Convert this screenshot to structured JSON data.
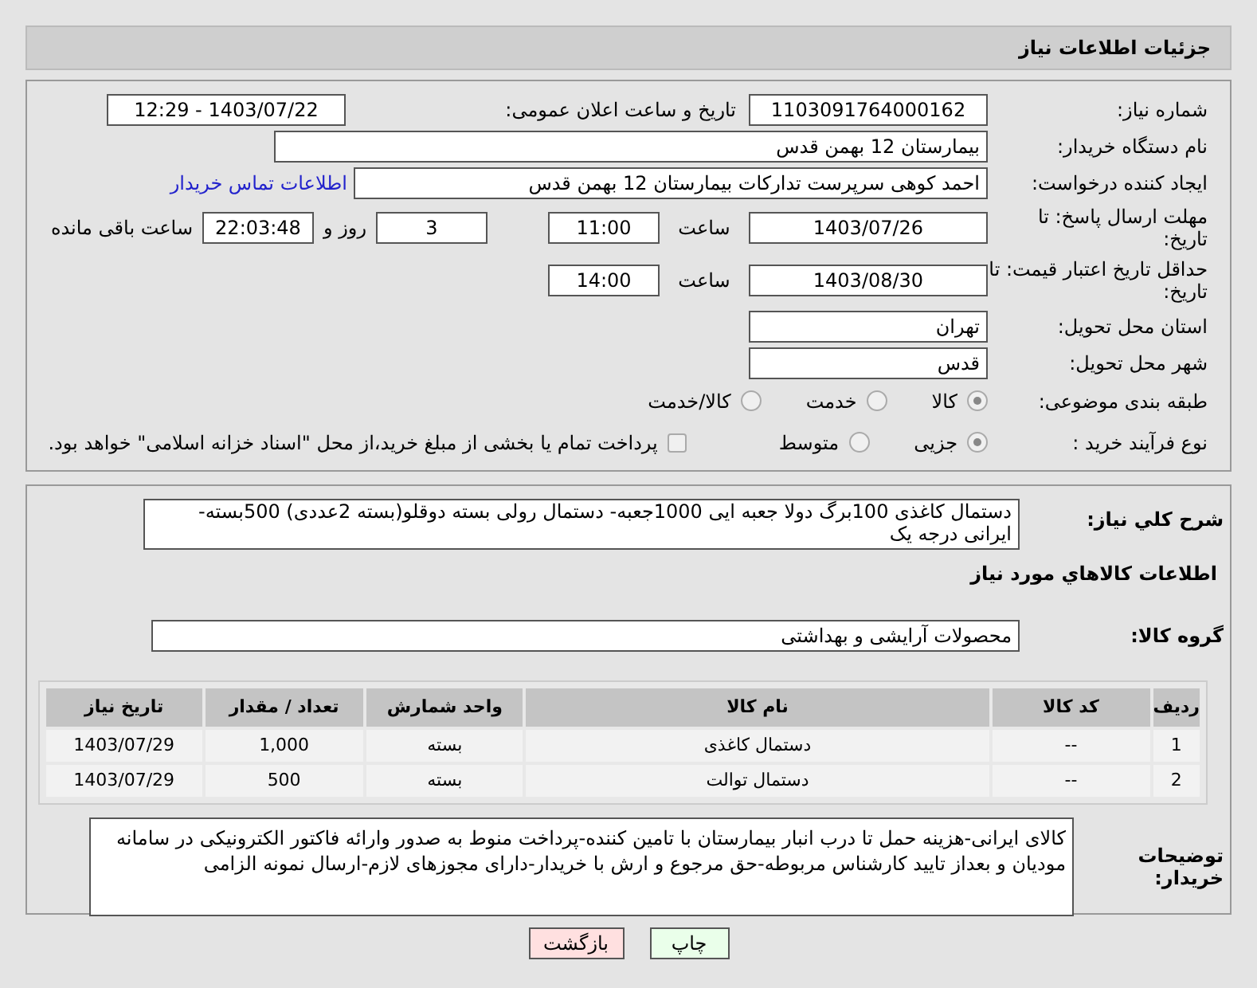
{
  "header": {
    "title": "جزئیات اطلاعات نیاز"
  },
  "need_number": {
    "label": "شماره نیاز:",
    "value": "1103091764000162"
  },
  "announce": {
    "label": "تاریخ و ساعت اعلان عمومی:",
    "value": "1403/07/22 - 12:29"
  },
  "buyer_org": {
    "label": "نام دستگاه خریدار:",
    "value": "بیمارستان 12 بهمن قدس"
  },
  "requester": {
    "label": "ایجاد کننده درخواست:",
    "value": "احمد کوهی سرپرست تدارکات بیمارستان 12 بهمن قدس",
    "link": "اطلاعات تماس خریدار"
  },
  "deadline": {
    "label": "مهلت ارسال پاسخ: تا تاریخ:",
    "date": "1403/07/26",
    "time_label": "ساعت",
    "time": "11:00",
    "days": "3",
    "days_label": "روز و",
    "remaining": "22:03:48",
    "remaining_label": "ساعت باقی مانده"
  },
  "validity": {
    "label": "حداقل تاریخ اعتبار قیمت: تا تاریخ:",
    "date": "1403/08/30",
    "time_label": "ساعت",
    "time": "14:00"
  },
  "province": {
    "label": "استان محل تحویل:",
    "value": "تهران"
  },
  "city": {
    "label": "شهر محل تحویل:",
    "value": "قدس"
  },
  "category": {
    "label": "طبقه بندی موضوعی:",
    "options": [
      {
        "label": "کالا",
        "selected": true
      },
      {
        "label": "خدمت",
        "selected": false
      },
      {
        "label": "کالا/خدمت",
        "selected": false
      }
    ]
  },
  "purchase_type": {
    "label": "نوع فرآیند خرید :",
    "options": [
      {
        "label": "جزیی",
        "selected": true
      },
      {
        "label": "متوسط",
        "selected": false
      }
    ],
    "checkbox": {
      "label": "پرداخت تمام یا بخشی از مبلغ خرید،از محل \"اسناد خزانه اسلامی\" خواهد بود.",
      "checked": false
    }
  },
  "description": {
    "label": "شرح کلي نياز:",
    "value": "دستمال کاغذی 100برگ دولا جعبه ایی 1000جعبه- دستمال رولی بسته دوقلو(بسته 2عددی) 500بسته-ایرانی درجه یک"
  },
  "goods_title": "اطلاعات کالاهاي مورد نياز",
  "goods_group": {
    "label": "گروه کالا:",
    "value": "محصولات آرایشی و بهداشتی"
  },
  "table": {
    "columns": [
      "ردیف",
      "کد کالا",
      "نام کالا",
      "واحد شمارش",
      "تعداد / مقدار",
      "تاریخ نیاز"
    ],
    "rows": [
      [
        "1",
        "--",
        "دستمال کاغذی",
        "بسته",
        "1,000",
        "1403/07/29"
      ],
      [
        "2",
        "--",
        "دستمال توالت",
        "بسته",
        "500",
        "1403/07/29"
      ]
    ]
  },
  "buyer_notes": {
    "label": "توضیحات خریدار:",
    "value": "کالای ایرانی-هزینه حمل تا درب  انبار بیمارستان با تامین کننده-پرداخت منوط به صدور وارائه فاکتور الکترونیکی  در سامانه مودیان و بعداز تایید کارشناس مربوطه-حق مرجوع و ارش با خریدار-دارای مجوزهای لازم-ارسال نمونه الزامی"
  },
  "buttons": [
    {
      "label": "چاپ",
      "kind": "print"
    },
    {
      "label": "بازگشت",
      "kind": "back"
    }
  ]
}
